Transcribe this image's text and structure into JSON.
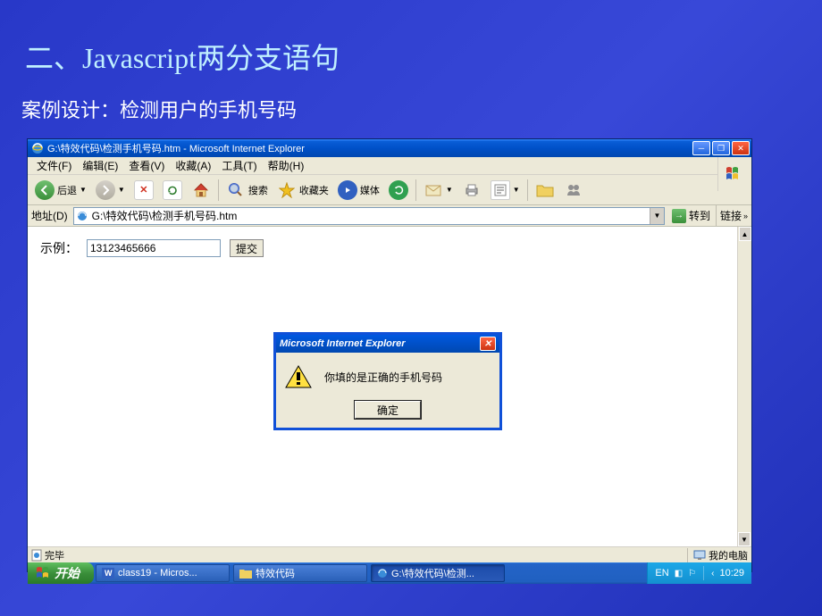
{
  "slide": {
    "title": "二、Javascript两分支语句",
    "subtitle": "案例设计：检测用户的手机号码"
  },
  "window": {
    "title": "G:\\特效代码\\检测手机号码.htm - Microsoft Internet Explorer",
    "menubar": [
      "文件(F)",
      "编辑(E)",
      "查看(V)",
      "收藏(A)",
      "工具(T)",
      "帮助(H)"
    ],
    "toolbar": {
      "back": "后退",
      "search": "搜索",
      "favorites": "收藏夹",
      "media": "媒体"
    },
    "address": {
      "label": "地址(D)",
      "value": "G:\\特效代码\\检测手机号码.htm",
      "go": "转到",
      "links": "链接"
    },
    "status": {
      "left": "完毕",
      "right": "我的电脑"
    }
  },
  "page": {
    "label": "示例：",
    "input_value": "13123465666",
    "submit": "提交"
  },
  "dialog": {
    "title": "Microsoft Internet Explorer",
    "message": "你填的是正确的手机号码",
    "ok": "确定"
  },
  "taskbar": {
    "start": "开始",
    "items": [
      "class19 - Micros...",
      "特效代码",
      "G:\\特效代码\\检测..."
    ],
    "lang": "EN",
    "time": "10:29"
  }
}
